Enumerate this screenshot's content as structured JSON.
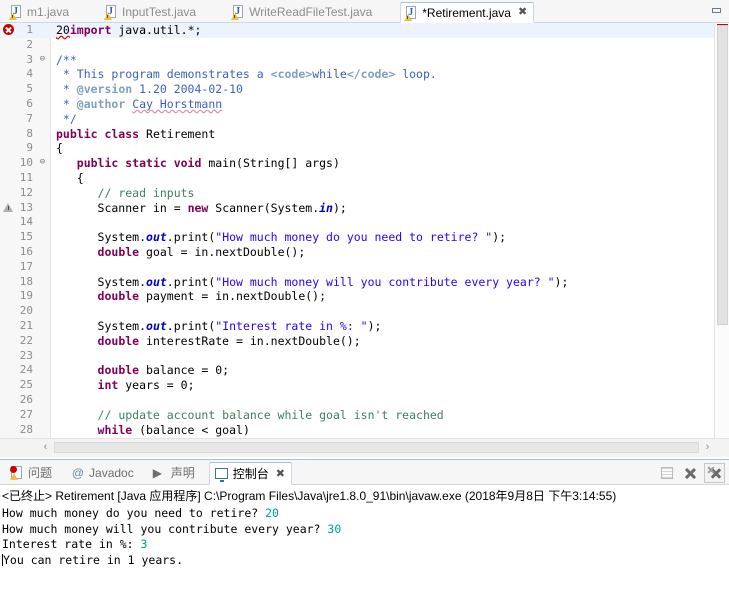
{
  "window": {
    "minimize_label": "Minimize"
  },
  "editor": {
    "tabs": [
      {
        "label": "m1.java",
        "active": false,
        "icon": "java-file-warning-icon"
      },
      {
        "label": "InputTest.java",
        "active": false,
        "icon": "java-file-warning-icon"
      },
      {
        "label": "WriteReadFileTest.java",
        "active": false,
        "icon": "java-file-warning-icon"
      },
      {
        "label": "*Retirement.java",
        "active": true,
        "icon": "java-file-warning-icon",
        "close_glyph": "✖"
      }
    ],
    "scroll": {
      "left_arrow": "‹",
      "right_arrow": "›"
    },
    "lines": [
      {
        "num": "1",
        "marker": "error",
        "fold": "",
        "highlight": true,
        "tokens": [
          {
            "t": "20",
            "c": "plain err-squiggle"
          },
          {
            "t": "import",
            "c": "kw"
          },
          {
            "t": " java.util.*;",
            "c": "plain"
          }
        ]
      },
      {
        "num": "2",
        "marker": "",
        "fold": "",
        "highlight": false,
        "tokens": []
      },
      {
        "num": "3",
        "marker": "",
        "fold": "⊖",
        "highlight": false,
        "tokens": [
          {
            "t": "/**",
            "c": "jdoc"
          }
        ]
      },
      {
        "num": "4",
        "marker": "",
        "fold": "",
        "highlight": false,
        "tokens": [
          {
            "t": " * This program demonstrates a ",
            "c": "jdoc"
          },
          {
            "t": "<code>",
            "c": "jtag"
          },
          {
            "t": "while",
            "c": "jdoc"
          },
          {
            "t": "</code>",
            "c": "jtag"
          },
          {
            "t": " loop.",
            "c": "jdoc"
          }
        ]
      },
      {
        "num": "5",
        "marker": "",
        "fold": "",
        "highlight": false,
        "tokens": [
          {
            "t": " * ",
            "c": "jdoc"
          },
          {
            "t": "@version",
            "c": "jtag"
          },
          {
            "t": " 1.20 2004-02-10",
            "c": "jdoc"
          }
        ]
      },
      {
        "num": "6",
        "marker": "",
        "fold": "",
        "highlight": false,
        "tokens": [
          {
            "t": " * ",
            "c": "jdoc"
          },
          {
            "t": "@author",
            "c": "jtag"
          },
          {
            "t": " ",
            "c": "jdoc"
          },
          {
            "t": "Cay Horstmann",
            "c": "jdoc spell"
          }
        ]
      },
      {
        "num": "7",
        "marker": "",
        "fold": "",
        "highlight": false,
        "tokens": [
          {
            "t": " */",
            "c": "jdoc"
          }
        ]
      },
      {
        "num": "8",
        "marker": "",
        "fold": "",
        "highlight": false,
        "tokens": [
          {
            "t": "public class",
            "c": "kw"
          },
          {
            "t": " Retirement",
            "c": "plain"
          }
        ]
      },
      {
        "num": "9",
        "marker": "",
        "fold": "",
        "highlight": false,
        "tokens": [
          {
            "t": "{",
            "c": "plain"
          }
        ]
      },
      {
        "num": "10",
        "marker": "",
        "fold": "⊖",
        "highlight": false,
        "tokens": [
          {
            "t": "   ",
            "c": "plain"
          },
          {
            "t": "public static void",
            "c": "kw"
          },
          {
            "t": " main(String[] args)",
            "c": "plain"
          }
        ]
      },
      {
        "num": "11",
        "marker": "",
        "fold": "",
        "highlight": false,
        "tokens": [
          {
            "t": "   {",
            "c": "plain"
          }
        ]
      },
      {
        "num": "12",
        "marker": "",
        "fold": "",
        "highlight": false,
        "tokens": [
          {
            "t": "      ",
            "c": "plain"
          },
          {
            "t": "// read inputs",
            "c": "cmt"
          }
        ]
      },
      {
        "num": "13",
        "marker": "warning",
        "fold": "",
        "highlight": false,
        "tokens": [
          {
            "t": "      Scanner in = ",
            "c": "plain"
          },
          {
            "t": "new",
            "c": "kw"
          },
          {
            "t": " Scanner(System.",
            "c": "plain"
          },
          {
            "t": "in",
            "c": "fld"
          },
          {
            "t": ");",
            "c": "plain"
          }
        ]
      },
      {
        "num": "14",
        "marker": "",
        "fold": "",
        "highlight": false,
        "tokens": []
      },
      {
        "num": "15",
        "marker": "",
        "fold": "",
        "highlight": false,
        "tokens": [
          {
            "t": "      System.",
            "c": "plain"
          },
          {
            "t": "out",
            "c": "fld"
          },
          {
            "t": ".print(",
            "c": "plain"
          },
          {
            "t": "\"How much money do you need to retire? \"",
            "c": "str"
          },
          {
            "t": ");",
            "c": "plain"
          }
        ]
      },
      {
        "num": "16",
        "marker": "",
        "fold": "",
        "highlight": false,
        "tokens": [
          {
            "t": "      ",
            "c": "plain"
          },
          {
            "t": "double",
            "c": "kw"
          },
          {
            "t": " goal = in.nextDouble();",
            "c": "plain"
          }
        ]
      },
      {
        "num": "17",
        "marker": "",
        "fold": "",
        "highlight": false,
        "tokens": []
      },
      {
        "num": "18",
        "marker": "",
        "fold": "",
        "highlight": false,
        "tokens": [
          {
            "t": "      System.",
            "c": "plain"
          },
          {
            "t": "out",
            "c": "fld"
          },
          {
            "t": ".print(",
            "c": "plain"
          },
          {
            "t": "\"How much money will you contribute every year? \"",
            "c": "str"
          },
          {
            "t": ");",
            "c": "plain"
          }
        ]
      },
      {
        "num": "19",
        "marker": "",
        "fold": "",
        "highlight": false,
        "tokens": [
          {
            "t": "      ",
            "c": "plain"
          },
          {
            "t": "double",
            "c": "kw"
          },
          {
            "t": " payment = in.nextDouble();",
            "c": "plain"
          }
        ]
      },
      {
        "num": "20",
        "marker": "",
        "fold": "",
        "highlight": false,
        "tokens": []
      },
      {
        "num": "21",
        "marker": "",
        "fold": "",
        "highlight": false,
        "tokens": [
          {
            "t": "      System.",
            "c": "plain"
          },
          {
            "t": "out",
            "c": "fld"
          },
          {
            "t": ".print(",
            "c": "plain"
          },
          {
            "t": "\"Interest rate in %: \"",
            "c": "str"
          },
          {
            "t": ");",
            "c": "plain"
          }
        ]
      },
      {
        "num": "22",
        "marker": "",
        "fold": "",
        "highlight": false,
        "tokens": [
          {
            "t": "      ",
            "c": "plain"
          },
          {
            "t": "double",
            "c": "kw"
          },
          {
            "t": " interestRate = in.nextDouble();",
            "c": "plain"
          }
        ]
      },
      {
        "num": "23",
        "marker": "",
        "fold": "",
        "highlight": false,
        "tokens": []
      },
      {
        "num": "24",
        "marker": "",
        "fold": "",
        "highlight": false,
        "tokens": [
          {
            "t": "      ",
            "c": "plain"
          },
          {
            "t": "double",
            "c": "kw"
          },
          {
            "t": " balance = 0;",
            "c": "plain"
          }
        ]
      },
      {
        "num": "25",
        "marker": "",
        "fold": "",
        "highlight": false,
        "tokens": [
          {
            "t": "      ",
            "c": "plain"
          },
          {
            "t": "int",
            "c": "kw"
          },
          {
            "t": " years = 0;",
            "c": "plain"
          }
        ]
      },
      {
        "num": "26",
        "marker": "",
        "fold": "",
        "highlight": false,
        "tokens": []
      },
      {
        "num": "27",
        "marker": "",
        "fold": "",
        "highlight": false,
        "tokens": [
          {
            "t": "      ",
            "c": "plain"
          },
          {
            "t": "// update account balance while goal isn't reached",
            "c": "cmt"
          }
        ]
      },
      {
        "num": "28",
        "marker": "",
        "fold": "",
        "highlight": false,
        "tokens": [
          {
            "t": "      ",
            "c": "plain"
          },
          {
            "t": "while",
            "c": "kw"
          },
          {
            "t": " (balance < goal)",
            "c": "plain"
          }
        ]
      }
    ]
  },
  "console": {
    "tabs": [
      {
        "label": "问题",
        "icon": "problems-icon",
        "active": false
      },
      {
        "label": "Javadoc",
        "icon": "javadoc-icon",
        "active": false
      },
      {
        "label": "声明",
        "icon": "declaration-icon",
        "active": false
      },
      {
        "label": "控制台",
        "icon": "console-icon",
        "active": true,
        "close_glyph": "✖"
      }
    ],
    "toolbar": [
      {
        "name": "clear-console-button",
        "icon": "clear-icon"
      },
      {
        "name": "terminate-button",
        "icon": "x-icon"
      },
      {
        "name": "remove-all-terminated-button",
        "icon": "x-all-icon"
      }
    ],
    "header": "<已终止> Retirement [Java 应用程序] C:\\Program Files\\Java\\jre1.8.0_91\\bin\\javaw.exe  (2018年9月8日 下午3:14:55)",
    "output_lines": [
      {
        "prompt": "How much money do you need to retire? ",
        "input": "20"
      },
      {
        "prompt": "How much money will you contribute every year? ",
        "input": "30"
      },
      {
        "prompt": "Interest rate in %: ",
        "input": "3"
      },
      {
        "prompt": "You can retire in 1 years.",
        "input": ""
      }
    ]
  },
  "colors": {
    "keyword": "#7f0055",
    "string": "#2a00ff",
    "comment": "#3f7f5f",
    "javadoc": "#3f5fbf",
    "javadoc_tag": "#7f9fbf",
    "field": "#0000c0",
    "error": "#cc0000",
    "console_input": "#00a08a",
    "line_highlight": "#ecf3fd",
    "tab_border": "#a8c0dd"
  }
}
